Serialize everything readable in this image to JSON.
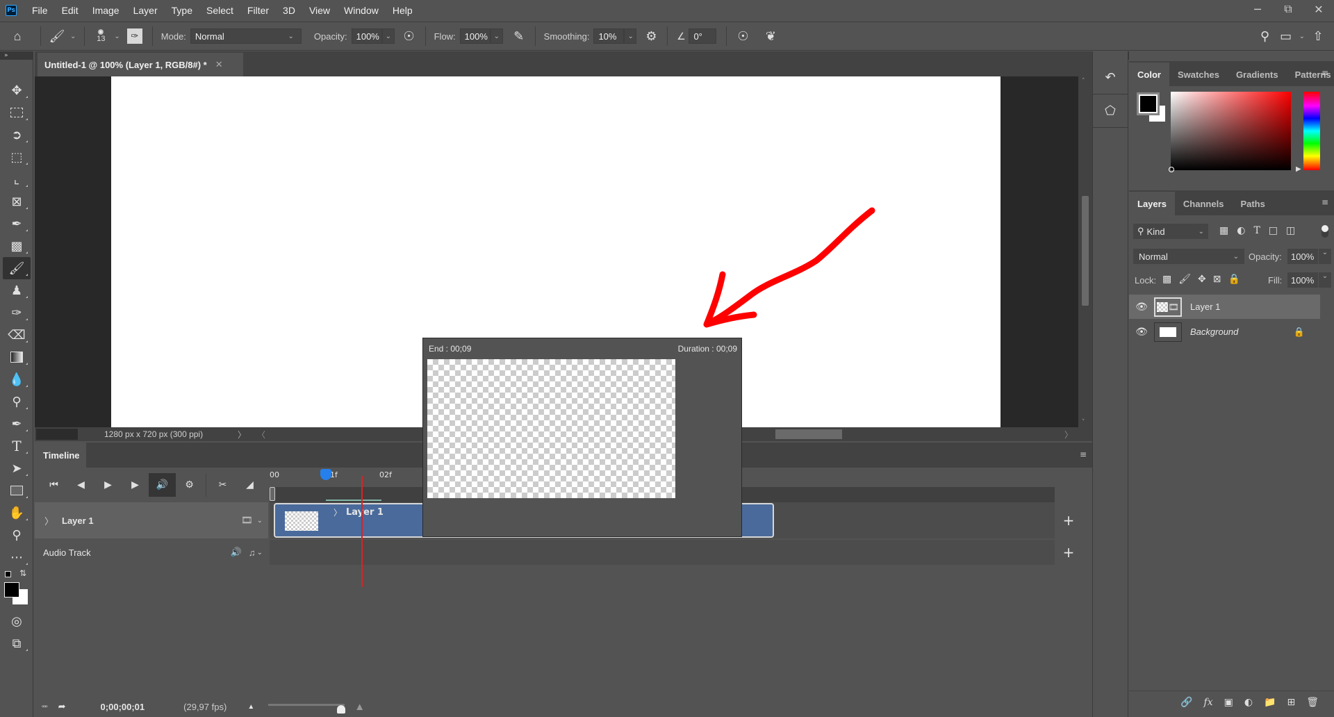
{
  "app": {
    "logo": "Ps"
  },
  "menubar": {
    "items": [
      "File",
      "Edit",
      "Image",
      "Layer",
      "Type",
      "Select",
      "Filter",
      "3D",
      "View",
      "Window",
      "Help"
    ]
  },
  "window_controls": {
    "minimize": "minimize-icon",
    "restore": "restore-icon",
    "close": "close-icon"
  },
  "options_bar": {
    "brush_size": "13",
    "mode_label": "Mode:",
    "mode_value": "Normal",
    "opacity_label": "Opacity:",
    "opacity_value": "100%",
    "flow_label": "Flow:",
    "flow_value": "100%",
    "smoothing_label": "Smoothing:",
    "smoothing_value": "10%",
    "angle_value": "0°"
  },
  "document": {
    "tab_title": "Untitled-1 @ 100% (Layer 1, RGB/8#) *",
    "status_info": "1280 px x 720 px (300 ppi)",
    "annotation_color": "#ff0000"
  },
  "tools": [
    "move",
    "marquee",
    "lasso",
    "object-select",
    "crop",
    "frame",
    "eyedropper",
    "healing",
    "brush",
    "stamp",
    "history-brush",
    "eraser",
    "gradient",
    "blur",
    "dodge",
    "pen",
    "type",
    "path-select",
    "rectangle",
    "hand",
    "zoom",
    "more"
  ],
  "timeline": {
    "tab": "Timeline",
    "ruler_labels": [
      "00",
      "01f",
      "02f"
    ],
    "tracks": [
      {
        "name": "Layer 1",
        "clip_label": "Layer 1"
      },
      {
        "name": "Audio Track"
      }
    ],
    "current_time": "0;00;00;01",
    "fps": "(29,97 fps)",
    "zoom_level": 0.95
  },
  "clip_tooltip": {
    "end": "End : 00;09",
    "duration": "Duration : 00;09"
  },
  "color_panel": {
    "tabs": [
      "Color",
      "Swatches",
      "Gradients",
      "Patterns"
    ],
    "active_tab": "Color",
    "foreground": "#000000",
    "background": "#ffffff",
    "hue_base": "#ff0000"
  },
  "layers_panel": {
    "tabs": [
      "Layers",
      "Channels",
      "Paths"
    ],
    "active_tab": "Layers",
    "filter_label": "Kind",
    "blend_mode": "Normal",
    "opacity_label": "Opacity:",
    "opacity_value": "100%",
    "lock_label": "Lock:",
    "fill_label": "Fill:",
    "fill_value": "100%",
    "layers": [
      {
        "name": "Layer 1",
        "visible": true,
        "selected": true
      },
      {
        "name": "Background",
        "visible": true,
        "locked": true
      }
    ]
  }
}
